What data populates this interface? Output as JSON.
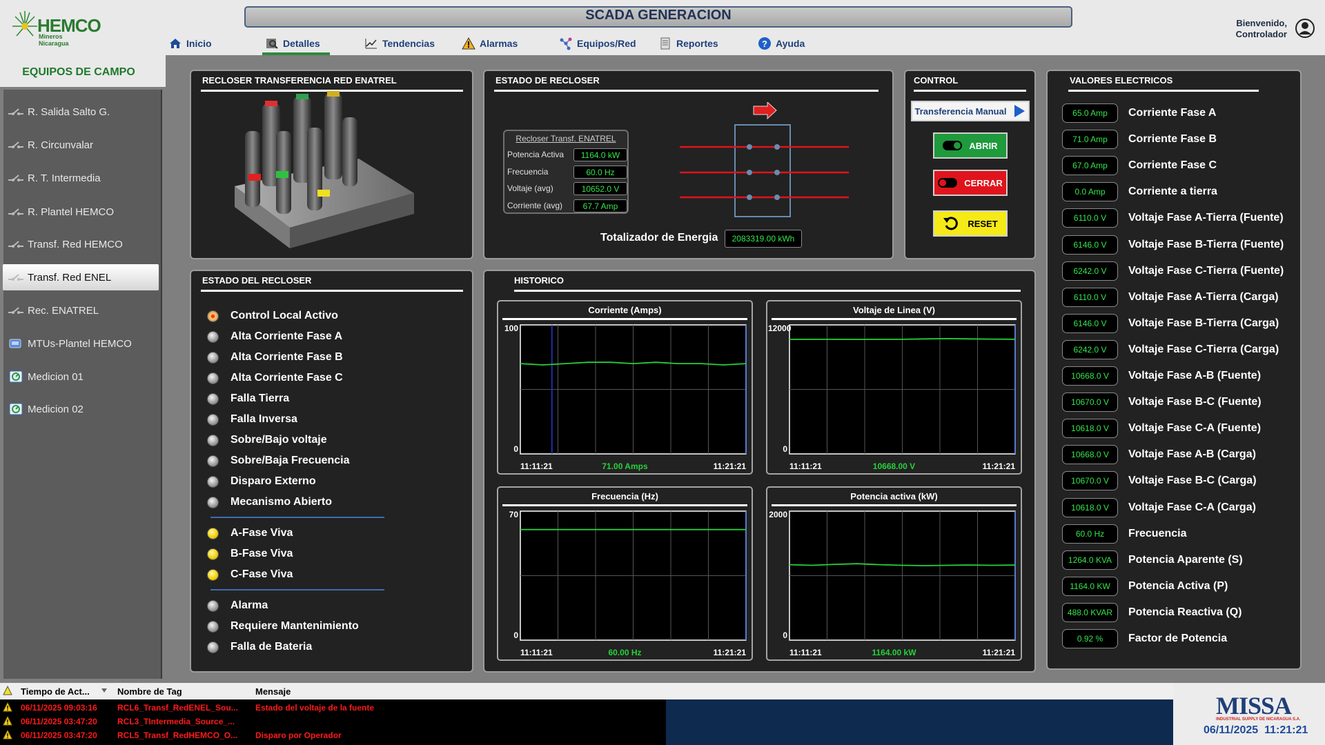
{
  "app": {
    "logo_text": "HEMCO",
    "logo_sub": "Mineros Nicaragua",
    "title": "SCADA GENERACION",
    "welcome": "Bienvenido,",
    "user": "Controlador"
  },
  "nav": [
    {
      "label": "Inicio",
      "icon": "home-icon"
    },
    {
      "label": "Detalles",
      "icon": "details-icon",
      "active": true
    },
    {
      "label": "Tendencias",
      "icon": "trend-icon"
    },
    {
      "label": "Alarmas",
      "icon": "alarm-warning-icon"
    },
    {
      "label": "Equipos/Red",
      "icon": "network-icon"
    },
    {
      "label": "Reportes",
      "icon": "report-icon"
    },
    {
      "label": "Ayuda",
      "icon": "help-icon"
    }
  ],
  "sidebar": {
    "title": "EQUIPOS DE CAMPO",
    "items": [
      {
        "label": "R. Salida Salto G.",
        "icon": "switch-icon"
      },
      {
        "label": "R. Circunvalar",
        "icon": "switch-icon"
      },
      {
        "label": "R. T. Intermedia",
        "icon": "switch-icon"
      },
      {
        "label": "R. Plantel HEMCO",
        "icon": "switch-icon"
      },
      {
        "label": "Transf. Red HEMCO",
        "icon": "switch-icon"
      },
      {
        "label": "Transf. Red ENEL",
        "icon": "switch-icon",
        "active": true
      },
      {
        "label": "Rec. ENATREL",
        "icon": "switch-icon"
      },
      {
        "label": "MTUs-Plantel HEMCO",
        "icon": "mtu-icon"
      },
      {
        "label": "Medicion 01",
        "icon": "meter-icon"
      },
      {
        "label": "Medicion 02",
        "icon": "meter-icon"
      }
    ]
  },
  "panels": {
    "recloser_img_title": "RECLOSER TRANSFERENCIA RED ENATREL",
    "estado_title": "ESTADO DE RECLOSER",
    "control_title": "CONTROL",
    "valores_title": "VALORES ELECTRICOS",
    "estado_del_title": "ESTADO DEL RECLOSER",
    "historico_title": "HISTORICO"
  },
  "recloser_info": {
    "title": "Recloser Transf. ENATREL",
    "rows": [
      {
        "label": "Potencia Activa",
        "value": "1164.0 kW"
      },
      {
        "label": "Frecuencia",
        "value": "60.0 Hz"
      },
      {
        "label": "Voltaje (avg)",
        "value": "10652.0 V"
      },
      {
        "label": "Corriente (avg)",
        "value": "67.7 Amp"
      }
    ],
    "energy_label": "Totalizador de Energia",
    "energy_value": "2083319.00 kWh"
  },
  "control": {
    "manual": "Transferencia Manual",
    "abrir": "ABRIR",
    "cerrar": "CERRAR",
    "reset": "RESET"
  },
  "valores": [
    {
      "value": "65.0 Amp",
      "label": "Corriente Fase A"
    },
    {
      "value": "71.0 Amp",
      "label": "Corriente Fase B"
    },
    {
      "value": "67.0 Amp",
      "label": "Corriente Fase C"
    },
    {
      "value": "0.0 Amp",
      "label": "Corriente a tierra"
    },
    {
      "value": "6110.0 V",
      "label": "Voltaje Fase A-Tierra (Fuente)"
    },
    {
      "value": "6146.0 V",
      "label": "Voltaje Fase B-Tierra (Fuente)"
    },
    {
      "value": "6242.0 V",
      "label": "Voltaje Fase C-Tierra (Fuente)"
    },
    {
      "value": "6110.0 V",
      "label": "Voltaje Fase A-Tierra (Carga)"
    },
    {
      "value": "6146.0 V",
      "label": "Voltaje Fase B-Tierra (Carga)"
    },
    {
      "value": "6242.0 V",
      "label": "Voltaje Fase C-Tierra (Carga)"
    },
    {
      "value": "10668.0 V",
      "label": "Voltaje Fase A-B (Fuente)"
    },
    {
      "value": "10670.0 V",
      "label": "Voltaje Fase B-C (Fuente)"
    },
    {
      "value": "10618.0 V",
      "label": "Voltaje Fase C-A (Fuente)"
    },
    {
      "value": "10668.0 V",
      "label": "Voltaje Fase A-B (Carga)"
    },
    {
      "value": "10670.0 V",
      "label": "Voltaje Fase B-C (Carga)"
    },
    {
      "value": "10618.0 V",
      "label": "Voltaje Fase C-A (Carga)"
    },
    {
      "value": "60.0 Hz",
      "label": "Frecuencia"
    },
    {
      "value": "1264.0 KVA",
      "label": "Potencia Aparente (S)"
    },
    {
      "value": "1164.0 KW",
      "label": "Potencia Activa (P)"
    },
    {
      "value": "488.0 KVAR",
      "label": "Potencia Reactiva (Q)"
    },
    {
      "value": "0.92 %",
      "label": "Factor de Potencia"
    }
  ],
  "estado": [
    {
      "label": "Control Local Activo",
      "state": "red"
    },
    {
      "label": "Alta Corriente Fase A",
      "state": "off"
    },
    {
      "label": "Alta Corriente Fase B",
      "state": "off"
    },
    {
      "label": "Alta Corriente Fase C",
      "state": "off"
    },
    {
      "label": "Falla Tierra",
      "state": "off"
    },
    {
      "label": "Falla Inversa",
      "state": "off"
    },
    {
      "label": "Sobre/Bajo voltaje",
      "state": "off"
    },
    {
      "label": "Sobre/Baja Frecuencia",
      "state": "off"
    },
    {
      "label": "Disparo Externo",
      "state": "off"
    },
    {
      "label": "Mecanismo Abierto",
      "state": "off"
    },
    {
      "label": "A-Fase Viva",
      "state": "yellow"
    },
    {
      "label": "B-Fase Viva",
      "state": "yellow"
    },
    {
      "label": "C-Fase Viva",
      "state": "yellow"
    },
    {
      "label": "Alarma",
      "state": "off"
    },
    {
      "label": "Requiere Mantenimiento",
      "state": "off"
    },
    {
      "label": "Falla de Bateria",
      "state": "off"
    }
  ],
  "chart_data": [
    {
      "type": "line",
      "title": "Corriente (Amps)",
      "ylim": [
        0,
        100
      ],
      "x": [
        "11:11:21",
        "11:21:21"
      ],
      "series": [
        {
          "values": [
            70,
            69,
            70,
            71,
            71,
            70,
            71,
            70,
            70,
            69,
            70
          ]
        }
      ],
      "current": "71.00 Amps"
    },
    {
      "type": "line",
      "title": "Voltaje de Linea (V)",
      "ylim": [
        0,
        12000
      ],
      "x": [
        "11:11:21",
        "11:21:21"
      ],
      "series": [
        {
          "values": [
            10650,
            10660,
            10660,
            10650,
            10660,
            10660,
            10700,
            10720,
            10700,
            10680,
            10668
          ]
        }
      ],
      "current": "10668.00 V"
    },
    {
      "type": "line",
      "title": "Frecuencia (Hz)",
      "ylim": [
        0,
        70
      ],
      "x": [
        "11:11:21",
        "11:21:21"
      ],
      "series": [
        {
          "values": [
            60,
            60,
            60,
            60,
            60,
            60,
            60,
            60,
            60,
            60,
            60
          ]
        }
      ],
      "current": "60.00 Hz"
    },
    {
      "type": "line",
      "title": "Potencia activa (kW)",
      "ylim": [
        0,
        2000
      ],
      "x": [
        "11:11:21",
        "11:21:21"
      ],
      "series": [
        {
          "values": [
            1170,
            1160,
            1175,
            1185,
            1170,
            1160,
            1155,
            1160,
            1165,
            1160,
            1164
          ]
        }
      ],
      "current": "1164.00 kW"
    }
  ],
  "alarms": {
    "headers": [
      "Tiempo de Act...",
      "Nombre de Tag",
      "Mensaje"
    ],
    "rows": [
      {
        "time": "06/11/2025 09:03:16",
        "tag": "RCL6_Transf_RedENEL_Sou...",
        "msg": "Estado del voltaje de la fuente"
      },
      {
        "time": "06/11/2025 03:47:20",
        "tag": "RCL3_TIntermedia_Source_...",
        "msg": ""
      },
      {
        "time": "06/11/2025 03:47:20",
        "tag": "RCL5_Transf_RedHEMCO_O...",
        "msg": "Disparo por Operador"
      }
    ]
  },
  "footer": {
    "brand": "MISSA",
    "brand_sub": "INDUSTRIAL SUPPLY DE NICARAGUA S.A.",
    "date": "06/11/2025",
    "time": "11:21:21"
  },
  "colors": {
    "accent": "#2e8b3c",
    "brand_blue": "#1f3f7a",
    "trend": "#26d13a",
    "alarm": "#ff1a1a"
  }
}
